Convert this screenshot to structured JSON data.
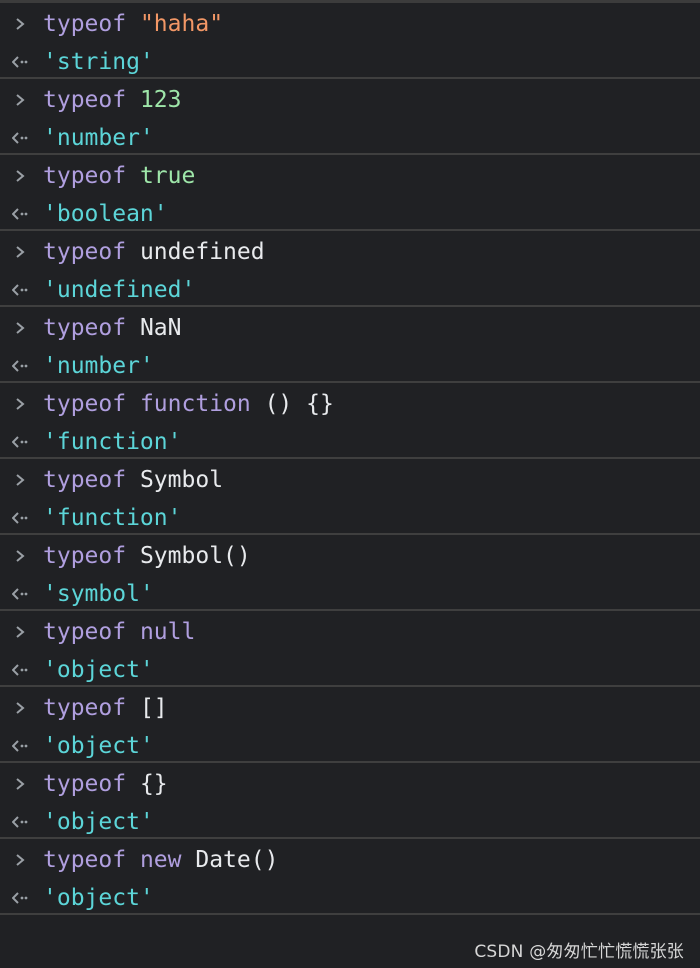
{
  "entries": [
    {
      "kw": "typeof",
      "space": " ",
      "arg": "\"haha\"",
      "arg_type": "str",
      "result": "'string'"
    },
    {
      "kw": "typeof",
      "space": " ",
      "arg": "123",
      "arg_type": "num",
      "result": "'number'"
    },
    {
      "kw": "typeof",
      "space": " ",
      "arg": "true",
      "arg_type": "bool",
      "result": "'boolean'"
    },
    {
      "kw": "typeof",
      "space": " ",
      "arg": "undefined",
      "arg_type": "plain",
      "result": "'undefined'"
    },
    {
      "kw": "typeof",
      "space": " ",
      "arg": "NaN",
      "arg_type": "plain",
      "result": "'number'"
    },
    {
      "kw": "typeof",
      "space": " ",
      "arg_kw": "function",
      "arg_rest": " () {}",
      "arg_type": "fn",
      "result": "'function'"
    },
    {
      "kw": "typeof",
      "space": " ",
      "arg": "Symbol",
      "arg_type": "plain",
      "result": "'function'"
    },
    {
      "kw": "typeof",
      "space": " ",
      "arg": "Symbol()",
      "arg_type": "plain",
      "result": "'symbol'"
    },
    {
      "kw": "typeof",
      "space": " ",
      "arg": "null",
      "arg_type": "kwarg",
      "result": "'object'"
    },
    {
      "kw": "typeof",
      "space": " ",
      "arg": "[]",
      "arg_type": "plain",
      "result": "'object'"
    },
    {
      "kw": "typeof",
      "space": " ",
      "arg": "{}",
      "arg_type": "plain",
      "result": "'object'"
    },
    {
      "kw": "typeof",
      "space": " ",
      "arg_kw": "new",
      "arg_rest": " Date()",
      "arg_type": "fn",
      "result": "'object'"
    }
  ],
  "icons": {
    "input_prompt": "chevron-right-icon",
    "output_prompt": "return-arrow-icon"
  },
  "colors": {
    "background": "#202124",
    "keyword": "#b09fdf",
    "string": "#f29766",
    "number": "#9ee6a9",
    "result": "#5cd5d8",
    "plain": "#e8eaed"
  },
  "watermark": "CSDN @匆匆忙忙慌慌张张"
}
